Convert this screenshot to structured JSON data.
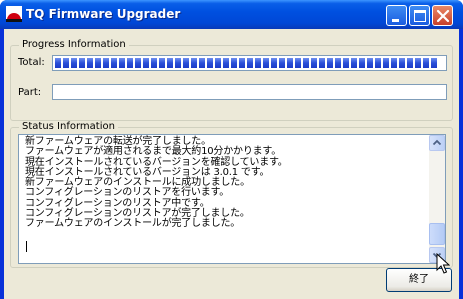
{
  "window": {
    "title": "TQ Firmware Upgrader",
    "titlebar_color": "#0050e0",
    "icon": "tq-logo-icon"
  },
  "progress": {
    "legend": "Progress Information",
    "total_label": "Total:",
    "part_label": "Part:",
    "total_fraction": 1.0,
    "part_fraction": 0.0,
    "bar_color": "#2a4fd8"
  },
  "status": {
    "legend": "Status Information",
    "lines": [
      "新ファームウェアの転送が完了しました。",
      "ファームウェアが適用されるまで最大約10分かかります。",
      "現在インストールされているバージョンを確認しています。",
      "現在インストールされているバージョンは 3.0.1 です。",
      "新ファームウェアのインストールに成功しました。",
      "コンフィグレーションのリストアを行います。",
      "コンフィグレーションのリストア中です。",
      "コンフィグレーションのリストアが完了しました。",
      "ファームウェアのインストールが完了しました。"
    ]
  },
  "buttons": {
    "finish_label": "終了"
  },
  "icons": {
    "minimize": "minimize-icon",
    "maximize": "maximize-icon",
    "close": "close-icon",
    "scroll_up": "chevron-up-icon",
    "scroll_down": "chevron-down-icon",
    "cursor": "mouse-pointer-icon"
  }
}
